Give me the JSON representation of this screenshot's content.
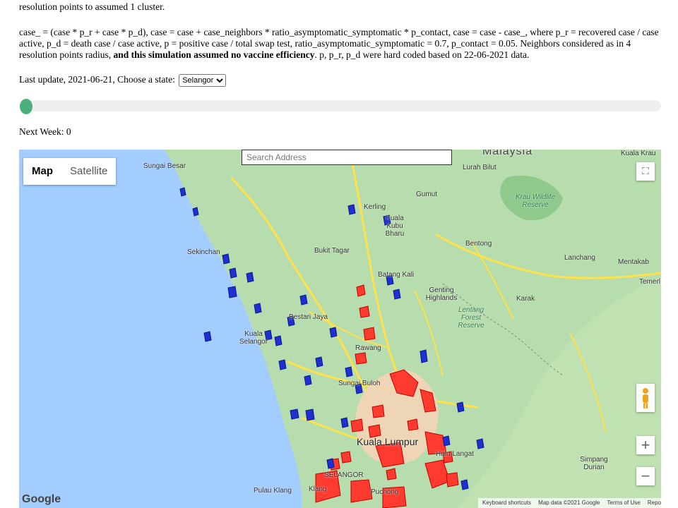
{
  "page": {
    "para1": "resolution points to assumed 1 cluster.",
    "para2_a": "case_ = (case * p_r + case * p_d), case = case + case_neighbors * ratio_asymptomatic_symptomatic * p_contact, case = case - case_, where p_r = recovered case / case active, p_d = death case / case active, p = positive case / total swap test, ratio_asymptomatic_symptomatic = 0.7, p_contact = 0.05. Neighbors considered as in 4 resolution points radius, ",
    "para2_b": "and this simulation assumed no vaccine efficiency",
    "para2_c": ". p, p_r, p_d were hard coded based on 22-06-2021 data.",
    "update_label": "Last update, 2021-06-21, Choose a state:",
    "state_selected": "Selangor",
    "slider_fraction": 0,
    "next_week_label": "Next Week: 0"
  },
  "map": {
    "search_placeholder": "Search Address",
    "type_map": "Map",
    "type_satellite": "Satellite",
    "fullscreen_icon": "fullscreen-icon",
    "pegman_icon": "pegman-icon",
    "zoom_in": "+",
    "zoom_out": "−",
    "google_logo": "Google",
    "footer": [
      "Keyboard shortcuts",
      "Map data ©2021 Google",
      "Terms of Use",
      "Report a map error"
    ],
    "labels": {
      "malaysia": "Malaysia",
      "kuala_krau": "Kuala Krau",
      "lurah_bilut": "Lurah Bilut",
      "krau": "Krau Wildlife Reserve",
      "bentong": "Bentong",
      "lanchang": "Lanchang",
      "mentakab": "Mentakab",
      "temerl": "Temerl",
      "karak": "Karak",
      "lentang": "Lentang Forest Reserve",
      "genting": "Genting Highlands",
      "bukit_tagar": "Bukit Tagar",
      "batang_kali": "Batang Kali",
      "kerling": "Kerling",
      "kuala_kubu": "Kuala Kubu Bharu",
      "gumut": "Gumut",
      "sungai_besar": "Sungai Besar",
      "sekinchan": "Sekinchan",
      "bestari_jaya": "Bestari Jaya",
      "kuala_selangor": "Kuala Selangor",
      "rawang": "Rawang",
      "sungai_buloh": "Sungai Buloh",
      "kuala_lumpur": "Kuala Lumpur",
      "hulu_langat": "Hulu Langat",
      "selangor": "SELANGOR",
      "klang": "Klang",
      "pulau_klang": "Pulau Klang",
      "simpang_durian": "Simpang Durian",
      "puchong": "Puchong"
    },
    "colors": {
      "sea": "#a3ccff",
      "land": "#b7dcad",
      "hot": "#ff3b30",
      "cluster": "#1f2fd0",
      "road": "#ffe24a"
    }
  }
}
